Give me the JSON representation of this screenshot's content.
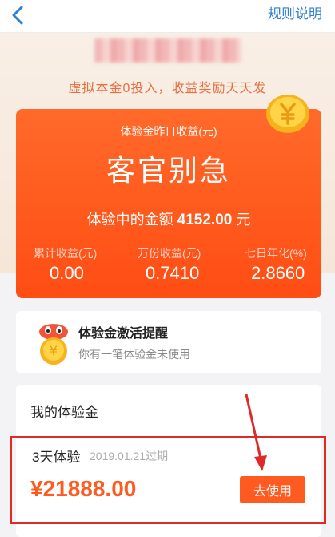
{
  "nav": {
    "rules_label": "规则说明"
  },
  "hero": {
    "subtitle": "虚拟本金0投入，收益奖励天天发"
  },
  "card": {
    "yesterday_label": "体验金昨日收益(元)",
    "yesterday_value": "客官别急",
    "amount_label": "体验中的金额",
    "amount_value": "4152.00",
    "amount_unit": "元",
    "stats": [
      {
        "label": "累计收益(元)",
        "value": "0.00"
      },
      {
        "label": "万份收益(元)",
        "value": "0.7410"
      },
      {
        "label": "七日年化(%)",
        "value": "2.8660"
      }
    ]
  },
  "reminder": {
    "title": "体验金激活提醒",
    "subtitle": "你有一笔体验金未使用"
  },
  "my": {
    "title": "我的体验金",
    "item": {
      "days": "3天体验",
      "expire": "2019.01.21过期",
      "amount": "¥21888.00",
      "button": "去使用"
    }
  },
  "colors": {
    "accent": "#ff5a1f",
    "link": "#2f80d0",
    "highlight_border": "#e02a2a"
  },
  "icons": [
    "back-chevron-icon",
    "gold-coin-icon",
    "coin-mascot-icon",
    "pointer-arrow-icon"
  ]
}
